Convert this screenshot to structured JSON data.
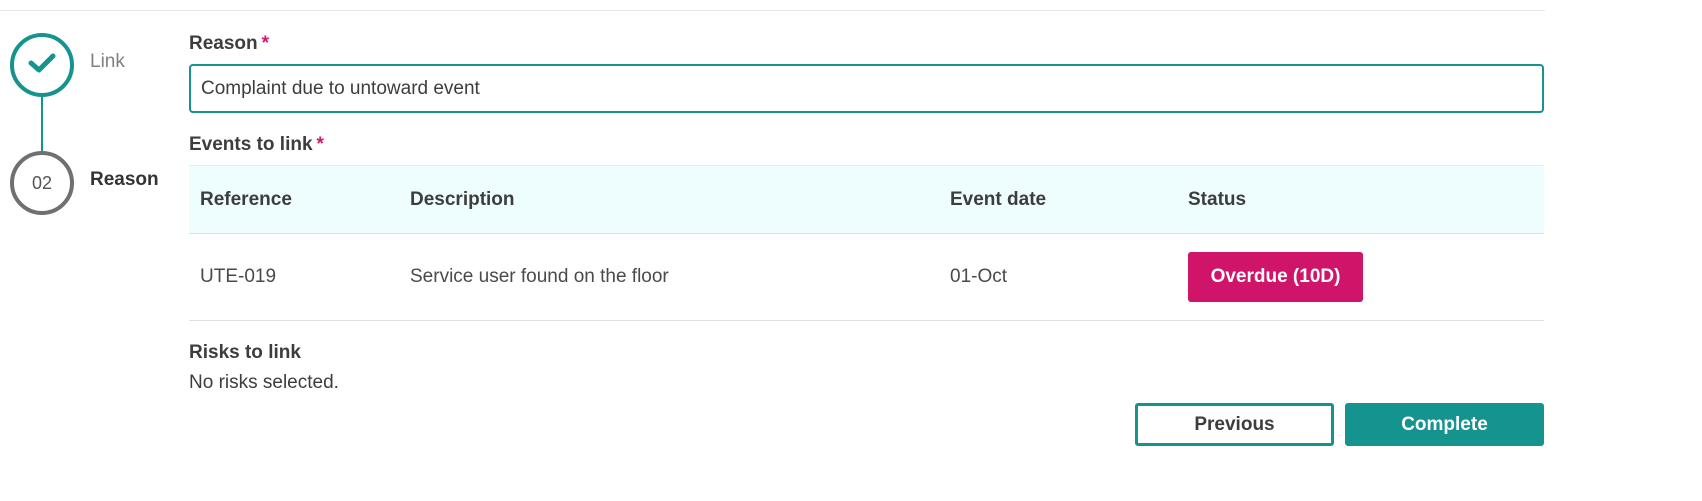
{
  "stepper": {
    "steps": [
      {
        "label": "Link",
        "state": "completed",
        "icon": "check-icon"
      },
      {
        "number": "02",
        "label": "Reason",
        "state": "active"
      }
    ],
    "colors": {
      "completed": "#14938f",
      "active": "#707070"
    }
  },
  "form": {
    "reason": {
      "label": "Reason",
      "required_marker": "*",
      "value": "Complaint due to untoward event"
    },
    "events": {
      "label": "Events to link",
      "required_marker": "*",
      "columns": [
        "Reference",
        "Description",
        "Event date",
        "Status"
      ],
      "rows": [
        {
          "reference": "UTE-019",
          "description": "Service user found on the floor",
          "event_date": "01-Oct",
          "status": "Overdue (10D)",
          "status_color": "#d0146a"
        }
      ]
    },
    "risks": {
      "label": "Risks to link",
      "empty_text": "No risks selected."
    }
  },
  "actions": {
    "previous_label": "Previous",
    "complete_label": "Complete"
  },
  "theme": {
    "accent": "#14938f",
    "required": "#d1196c",
    "table_header_bg": "#eefdfd"
  }
}
